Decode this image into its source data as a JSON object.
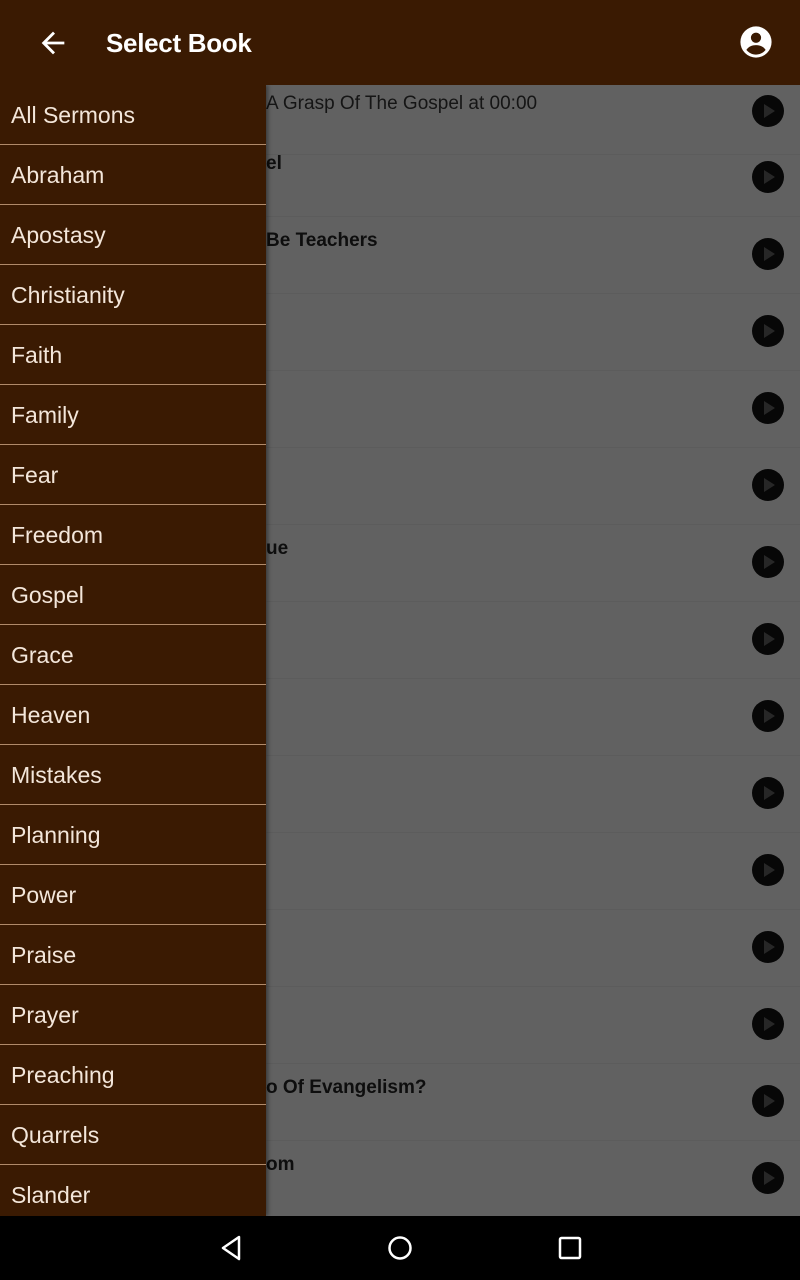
{
  "appbar": {
    "title": "Select Book",
    "back_icon": "arrow-left-icon",
    "account_icon": "account-circle-icon"
  },
  "colors": {
    "primary": "#3a1a02",
    "drawer_divider": "#b08a6a",
    "drawer_text": "#f3e6da"
  },
  "drawer": {
    "items": [
      {
        "label": "All Sermons"
      },
      {
        "label": "Abraham"
      },
      {
        "label": "Apostasy"
      },
      {
        "label": "Christianity"
      },
      {
        "label": "Faith"
      },
      {
        "label": "Family"
      },
      {
        "label": "Fear"
      },
      {
        "label": "Freedom"
      },
      {
        "label": "Gospel"
      },
      {
        "label": "Grace"
      },
      {
        "label": "Heaven"
      },
      {
        "label": "Mistakes"
      },
      {
        "label": "Planning"
      },
      {
        "label": "Power"
      },
      {
        "label": "Praise"
      },
      {
        "label": "Prayer"
      },
      {
        "label": "Preaching"
      },
      {
        "label": "Quarrels"
      },
      {
        "label": "Slander"
      }
    ]
  },
  "background_list": {
    "rows": [
      {
        "text": "A Grasp Of The Gospel at 00:00"
      },
      {
        "text": "el"
      },
      {
        "text": "Be Teachers"
      },
      {
        "text": ""
      },
      {
        "text": ""
      },
      {
        "text": ""
      },
      {
        "text": "ue"
      },
      {
        "text": ""
      },
      {
        "text": ""
      },
      {
        "text": ""
      },
      {
        "text": ""
      },
      {
        "text": ""
      },
      {
        "text": ""
      },
      {
        "text": "o Of Evangelism?"
      },
      {
        "text": "om"
      }
    ]
  },
  "system_nav": {
    "back": "nav-back-icon",
    "home": "nav-home-icon",
    "recents": "nav-recents-icon"
  }
}
